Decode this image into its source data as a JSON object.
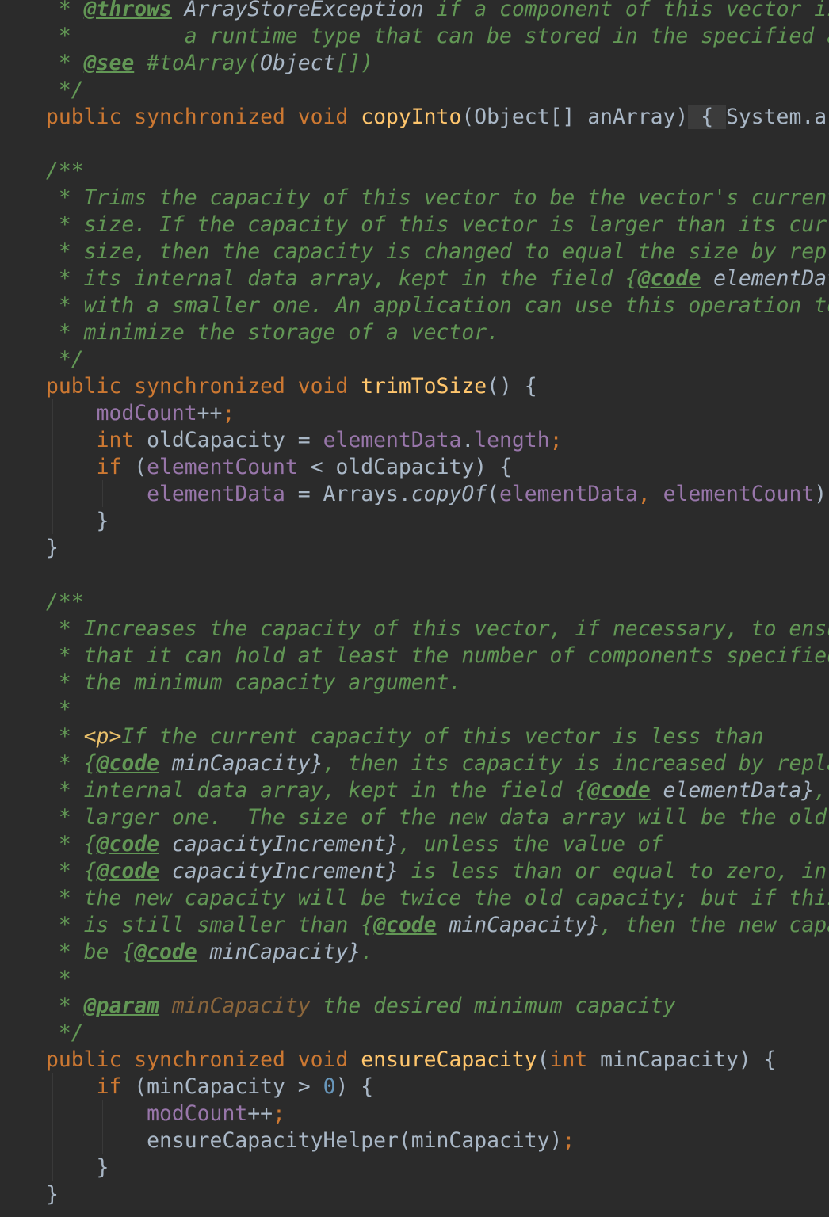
{
  "editor": {
    "theme_colors": {
      "background": "#2b2b2b",
      "keyword": "#cc7832",
      "method_declaration": "#ffc66d",
      "field": "#9876aa",
      "number": "#6897bb",
      "javadoc": "#629755",
      "plain": "#a9b7c6"
    },
    "lines": [
      [
        {
          "c": "t-doc",
          "t": " * "
        },
        {
          "c": "t-doctag",
          "t": "@throws"
        },
        {
          "c": "t-docref",
          "t": " ArrayStoreException"
        },
        {
          "c": "t-doc",
          "t": " if a component of this vector is not of"
        }
      ],
      [
        {
          "c": "t-doc",
          "t": " *         a runtime type that can be stored in the specified array"
        }
      ],
      [
        {
          "c": "t-doc",
          "t": " * "
        },
        {
          "c": "t-doctag",
          "t": "@see"
        },
        {
          "c": "t-doc",
          "t": " #toArray("
        },
        {
          "c": "t-docref",
          "t": "Object"
        },
        {
          "c": "t-doc",
          "t": "[])"
        }
      ],
      [
        {
          "c": "t-doc",
          "t": " */"
        }
      ],
      [
        {
          "c": "t-kw",
          "t": "public synchronized void "
        },
        {
          "c": "t-fn",
          "t": "copyInto"
        },
        {
          "c": "t-plain",
          "t": "(Object[] anArray)"
        },
        {
          "c": "t-fold",
          "t": " { "
        },
        {
          "c": "t-plain",
          "t": "System.arraycopy"
        }
      ],
      [],
      [
        {
          "c": "t-doc",
          "t": "/**"
        }
      ],
      [
        {
          "c": "t-doc",
          "t": " * Trims the capacity of this vector to be the vector's current"
        }
      ],
      [
        {
          "c": "t-doc",
          "t": " * size. If the capacity of this vector is larger than its current"
        }
      ],
      [
        {
          "c": "t-doc",
          "t": " * size, then the capacity is changed to equal the size by replacing"
        }
      ],
      [
        {
          "c": "t-doc",
          "t": " * its internal data array, kept in the field "
        },
        {
          "c": "t-doc",
          "t": "{"
        },
        {
          "c": "t-doctag",
          "t": "@code"
        },
        {
          "c": "t-docref",
          "t": " elementData}"
        }
      ],
      [
        {
          "c": "t-doc",
          "t": " * with a smaller one. An application can use this operation to"
        }
      ],
      [
        {
          "c": "t-doc",
          "t": " * minimize the storage of a vector."
        }
      ],
      [
        {
          "c": "t-doc",
          "t": " */"
        }
      ],
      [
        {
          "c": "t-kw",
          "t": "public synchronized void "
        },
        {
          "c": "t-fn",
          "t": "trimToSize"
        },
        {
          "c": "t-plain",
          "t": "() {"
        }
      ],
      [
        {
          "c": "t-plain",
          "t": "    "
        },
        {
          "c": "t-field",
          "t": "modCount"
        },
        {
          "c": "t-plain",
          "t": "++"
        },
        {
          "c": "t-kw",
          "t": ";"
        }
      ],
      [
        {
          "c": "t-plain",
          "t": "    "
        },
        {
          "c": "t-kw",
          "t": "int "
        },
        {
          "c": "t-plain",
          "t": "oldCapacity = "
        },
        {
          "c": "t-field",
          "t": "elementData"
        },
        {
          "c": "t-plain",
          "t": "."
        },
        {
          "c": "t-field",
          "t": "length"
        },
        {
          "c": "t-kw",
          "t": ";"
        }
      ],
      [
        {
          "c": "t-plain",
          "t": "    "
        },
        {
          "c": "t-kw",
          "t": "if "
        },
        {
          "c": "t-plain",
          "t": "("
        },
        {
          "c": "t-field",
          "t": "elementCount "
        },
        {
          "c": "t-plain",
          "t": "< oldCapacity) {"
        }
      ],
      [
        {
          "c": "t-plain",
          "t": "        "
        },
        {
          "c": "t-field",
          "t": "elementData "
        },
        {
          "c": "t-plain",
          "t": "= Arrays."
        },
        {
          "c": "t-ital",
          "t": "copyOf"
        },
        {
          "c": "t-plain",
          "t": "("
        },
        {
          "c": "t-field",
          "t": "elementData"
        },
        {
          "c": "t-kw",
          "t": ", "
        },
        {
          "c": "t-field",
          "t": "elementCount"
        },
        {
          "c": "t-plain",
          "t": ")"
        },
        {
          "c": "t-kw",
          "t": ";"
        }
      ],
      [
        {
          "c": "t-plain",
          "t": "    }"
        }
      ],
      [
        {
          "c": "t-plain",
          "t": "}"
        }
      ],
      [],
      [
        {
          "c": "t-doc",
          "t": "/**"
        }
      ],
      [
        {
          "c": "t-doc",
          "t": " * Increases the capacity of this vector, if necessary, to ensure"
        }
      ],
      [
        {
          "c": "t-doc",
          "t": " * that it can hold at least the number of components specified by"
        }
      ],
      [
        {
          "c": "t-doc",
          "t": " * the minimum capacity argument."
        }
      ],
      [
        {
          "c": "t-doc",
          "t": " *"
        }
      ],
      [
        {
          "c": "t-doc",
          "t": " * "
        },
        {
          "c": "t-html",
          "t": "<p>"
        },
        {
          "c": "t-doc",
          "t": "If the current capacity of this vector is less than"
        }
      ],
      [
        {
          "c": "t-doc",
          "t": " * {"
        },
        {
          "c": "t-doctag",
          "t": "@code"
        },
        {
          "c": "t-docref",
          "t": " minCapacity}"
        },
        {
          "c": "t-doc",
          "t": ", then its capacity is increased by replacing its"
        }
      ],
      [
        {
          "c": "t-doc",
          "t": " * internal data array, kept in the field {"
        },
        {
          "c": "t-doctag",
          "t": "@code"
        },
        {
          "c": "t-docref",
          "t": " elementData}"
        },
        {
          "c": "t-doc",
          "t": ", with a"
        }
      ],
      [
        {
          "c": "t-doc",
          "t": " * larger one.  The size of the new data array will be the old size plus"
        }
      ],
      [
        {
          "c": "t-doc",
          "t": " * {"
        },
        {
          "c": "t-doctag",
          "t": "@code"
        },
        {
          "c": "t-docref",
          "t": " capacityIncrement}"
        },
        {
          "c": "t-doc",
          "t": ", unless the value of"
        }
      ],
      [
        {
          "c": "t-doc",
          "t": " * {"
        },
        {
          "c": "t-doctag",
          "t": "@code"
        },
        {
          "c": "t-docref",
          "t": " capacityIncrement}"
        },
        {
          "c": "t-doc",
          "t": " is less than or equal to zero, in which case"
        }
      ],
      [
        {
          "c": "t-doc",
          "t": " * the new capacity will be twice the old capacity; but if this new size"
        }
      ],
      [
        {
          "c": "t-doc",
          "t": " * is still smaller than {"
        },
        {
          "c": "t-doctag",
          "t": "@code"
        },
        {
          "c": "t-docref",
          "t": " minCapacity}"
        },
        {
          "c": "t-doc",
          "t": ", then the new capacity will"
        }
      ],
      [
        {
          "c": "t-doc",
          "t": " * be {"
        },
        {
          "c": "t-doctag",
          "t": "@code"
        },
        {
          "c": "t-docref",
          "t": " minCapacity}"
        },
        {
          "c": "t-doc",
          "t": "."
        }
      ],
      [
        {
          "c": "t-doc",
          "t": " *"
        }
      ],
      [
        {
          "c": "t-doc",
          "t": " * "
        },
        {
          "c": "t-doctag",
          "t": "@param"
        },
        {
          "c": "t-docparam",
          "t": " minCapacity"
        },
        {
          "c": "t-doc",
          "t": " the desired minimum capacity"
        }
      ],
      [
        {
          "c": "t-doc",
          "t": " */"
        }
      ],
      [
        {
          "c": "t-kw",
          "t": "public synchronized void "
        },
        {
          "c": "t-fn",
          "t": "ensureCapacity"
        },
        {
          "c": "t-plain",
          "t": "("
        },
        {
          "c": "t-kw",
          "t": "int "
        },
        {
          "c": "t-plain",
          "t": "minCapacity) {"
        }
      ],
      [
        {
          "c": "t-plain",
          "t": "    "
        },
        {
          "c": "t-kw",
          "t": "if "
        },
        {
          "c": "t-plain",
          "t": "(minCapacity > "
        },
        {
          "c": "t-num",
          "t": "0"
        },
        {
          "c": "t-plain",
          "t": ") {"
        }
      ],
      [
        {
          "c": "t-plain",
          "t": "        "
        },
        {
          "c": "t-field",
          "t": "modCount"
        },
        {
          "c": "t-plain",
          "t": "++"
        },
        {
          "c": "t-kw",
          "t": ";"
        }
      ],
      [
        {
          "c": "t-plain",
          "t": "        ensureCapacityHelper(minCapacity)"
        },
        {
          "c": "t-kw",
          "t": ";"
        }
      ],
      [
        {
          "c": "t-plain",
          "t": "    }"
        }
      ],
      [
        {
          "c": "t-plain",
          "t": "}"
        }
      ]
    ]
  }
}
